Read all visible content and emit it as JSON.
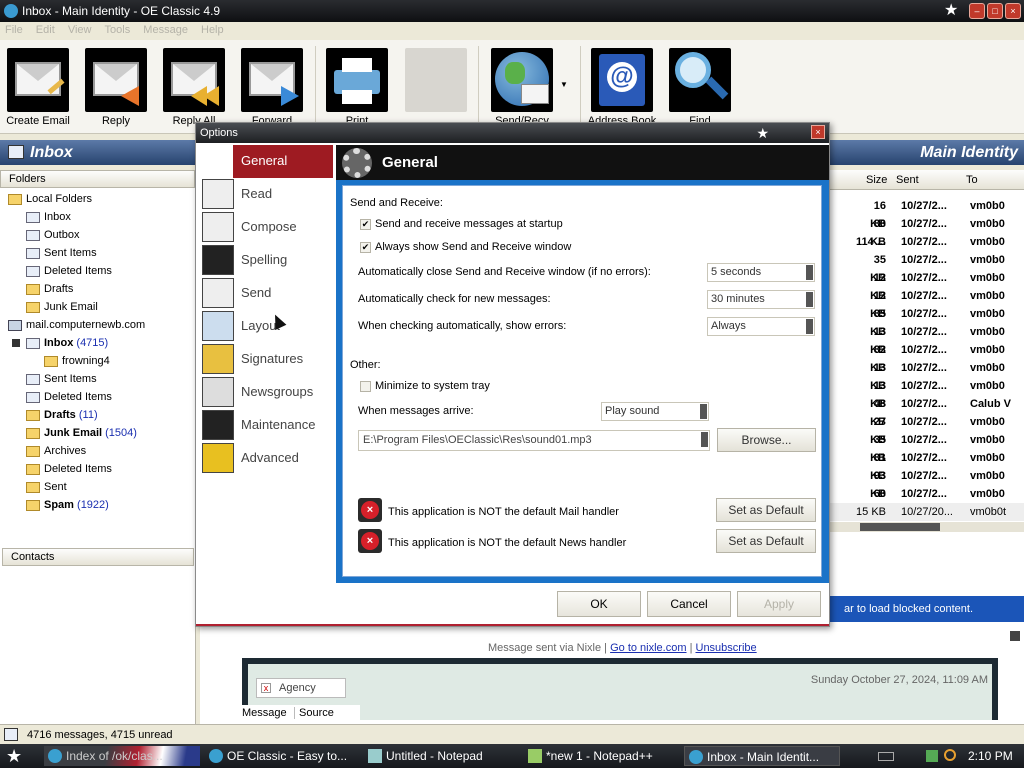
{
  "window": {
    "title": "Inbox - Main Identity - OE Classic 4.9",
    "min": "–",
    "max": "□",
    "close": "×"
  },
  "menu": [
    "File",
    "Edit",
    "View",
    "Tools",
    "Message",
    "Help"
  ],
  "toolbar": {
    "create": "Create Email",
    "reply": "Reply",
    "reply_all": "Reply All",
    "forward": "Forward",
    "print": "Print",
    "send_recv": "Send/Recv",
    "address_book": "Address Book",
    "find": "Find"
  },
  "header": {
    "folder": "Inbox",
    "identity": "Main Identity"
  },
  "folders": {
    "header": "Folders",
    "local": "Local Folders",
    "local_items": [
      "Inbox",
      "Outbox",
      "Sent Items",
      "Deleted Items",
      "Drafts",
      "Junk Email"
    ],
    "account": "mail.computernewb.com",
    "acct_inbox": "Inbox",
    "acct_inbox_count": "(4715)",
    "sub": "frowning4",
    "acct_items_plain": [
      "Sent Items",
      "Deleted Items"
    ],
    "drafts": "Drafts",
    "drafts_count": "(11)",
    "junk": "Junk Email",
    "junk_count": "(1504)",
    "acct_items_plain2": [
      "Archives",
      "Deleted Items",
      "Sent"
    ],
    "spam": "Spam",
    "spam_count": "(1922)"
  },
  "contacts": {
    "header": "Contacts"
  },
  "list": {
    "headers": {
      "size": "Size",
      "sent": "Sent",
      "to": "To"
    },
    "rows": [
      {
        "size": "16 KB",
        "sent": "10/27/2...",
        "to": "vm0b0"
      },
      {
        "size": "80 KB",
        "sent": "10/27/2...",
        "to": "vm0b0"
      },
      {
        "size": "114 ...",
        "sent": "10/27/2...",
        "to": "vm0b0"
      },
      {
        "size": "35 KB",
        "sent": "10/27/2...",
        "to": "vm0b0"
      },
      {
        "size": "12 KB",
        "sent": "10/27/2...",
        "to": "vm0b0"
      },
      {
        "size": "12 KB",
        "sent": "10/27/2...",
        "to": "vm0b0"
      },
      {
        "size": "85 KB",
        "sent": "10/27/2...",
        "to": "vm0b0"
      },
      {
        "size": "13 KB",
        "sent": "10/27/2...",
        "to": "vm0b0"
      },
      {
        "size": "82 KB",
        "sent": "10/27/2...",
        "to": "vm0b0"
      },
      {
        "size": "13 KB",
        "sent": "10/27/2...",
        "to": "vm0b0"
      },
      {
        "size": "13 KB",
        "sent": "10/27/2...",
        "to": "vm0b0"
      },
      {
        "size": "48 KB",
        "sent": "10/27/2...",
        "to": "Calub V"
      },
      {
        "size": "27 KB",
        "sent": "10/27/2...",
        "to": "vm0b0"
      },
      {
        "size": "35 KB",
        "sent": "10/27/2...",
        "to": "vm0b0"
      },
      {
        "size": "81 KB",
        "sent": "10/27/2...",
        "to": "vm0b0"
      },
      {
        "size": "93 KB",
        "sent": "10/27/2...",
        "to": "vm0b0"
      },
      {
        "size": "60 KB",
        "sent": "10/27/2...",
        "to": "vm0b0"
      },
      {
        "size": "15 KB",
        "sent": "10/27/20...",
        "to": "vm0b0t"
      }
    ]
  },
  "preview": {
    "blocked": "ar to load blocked content.",
    "footer_text": "Message sent via Nixle |",
    "footer_link1": "Go to nixle.com",
    "footer_sep": "|",
    "footer_link2": "Unsubscribe",
    "agency": "Agency",
    "date": "Sunday October 27, 2024, 11:09 AM",
    "tab_message": "Message",
    "tab_source": "Source"
  },
  "status": {
    "text": "4716 messages, 4715 unread"
  },
  "taskbar": {
    "tasks": [
      "Index of /ok/clas...",
      "OE Classic - Easy to...",
      "Untitled - Notepad",
      "*new 1 - Notepad++",
      "Inbox - Main Identit..."
    ],
    "clock": "2:10 PM"
  },
  "dialog": {
    "title": "Options",
    "categories": [
      "General",
      "Read",
      "Compose",
      "Spelling",
      "Send",
      "Layout",
      "Signatures",
      "Newsgroups",
      "Maintenance",
      "Advanced"
    ],
    "panel_title": "General",
    "send_receive_label": "Send and Receive:",
    "chk_startup": "Send and receive messages at startup",
    "chk_window": "Always show Send and Receive window",
    "auto_close_label": "Automatically close Send and Receive window (if no errors):",
    "auto_close_value": "5 seconds",
    "auto_check_label": "Automatically check for new messages:",
    "auto_check_value": "30 minutes",
    "show_errors_label": "When checking automatically, show errors:",
    "show_errors_value": "Always",
    "other_label": "Other:",
    "chk_tray": "Minimize to system tray",
    "arrive_label": "When messages arrive:",
    "arrive_value": "Play sound",
    "sound_path": "E:\\Program Files\\OEClassic\\Res\\sound01.mp3",
    "browse": "Browse...",
    "mail_handler": "This application is NOT the default Mail handler",
    "news_handler": "This application is NOT the default News handler",
    "set_default": "Set as Default",
    "ok": "OK",
    "cancel": "Cancel",
    "apply": "Apply"
  }
}
